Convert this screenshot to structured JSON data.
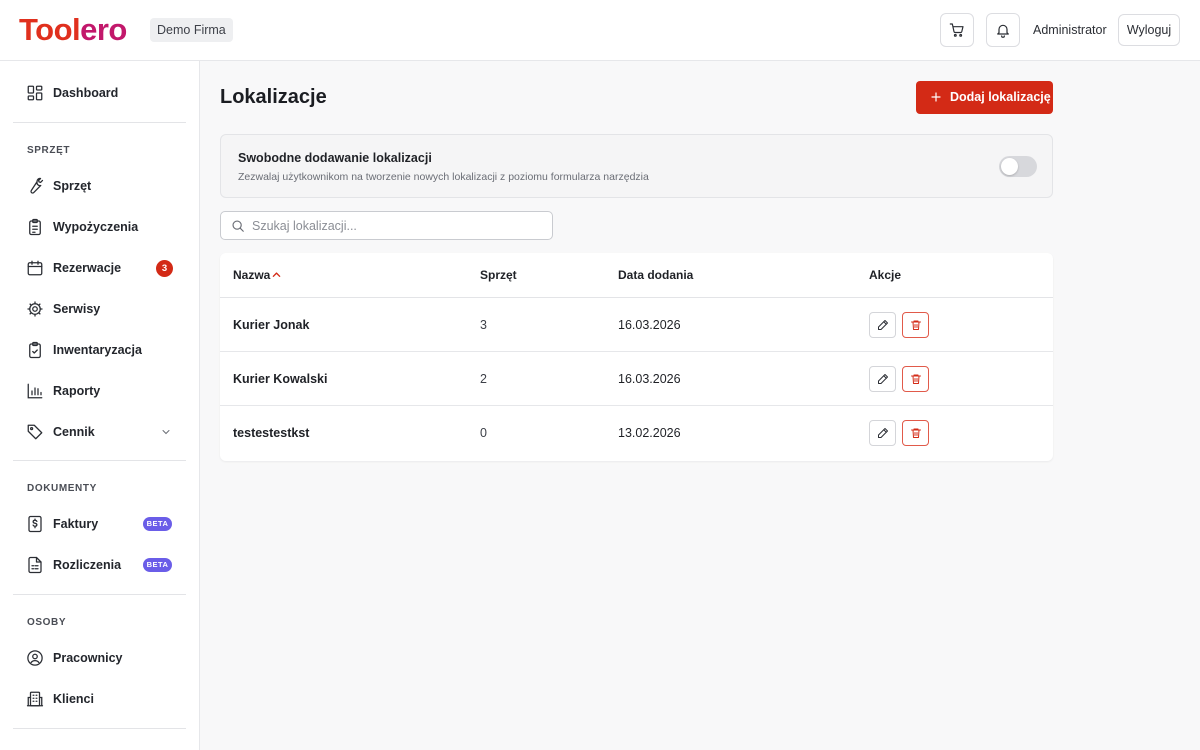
{
  "header": {
    "logo_part1": "Tool",
    "logo_part2": "ero",
    "company": "Demo Firma",
    "user": "Administrator",
    "logout_label": "Wyloguj",
    "cart_icon": "cart-icon",
    "bell_icon": "bell-icon"
  },
  "sidebar": {
    "dashboard": "Dashboard",
    "sections": {
      "equipment": "SPRZĘT",
      "documents": "DOKUMENTY",
      "people": "OSOBY"
    },
    "items": {
      "sprzet": "Sprzęt",
      "wypozyczenia": "Wypożyczenia",
      "rezerwacje": "Rezerwacje",
      "rezerwacje_badge": "3",
      "serwisy": "Serwisy",
      "inwentaryzacja": "Inwentaryzacja",
      "raporty": "Raporty",
      "cennik": "Cennik",
      "faktury": "Faktury",
      "faktury_badge": "BETA",
      "rozliczenia": "Rozliczenia",
      "rozliczenia_badge": "BETA",
      "pracownicy": "Pracownicy",
      "klienci": "Klienci"
    }
  },
  "main": {
    "title": "Lokalizacje",
    "add_button": "Dodaj lokalizację",
    "setting": {
      "title": "Swobodne dodawanie lokalizacji",
      "description": "Zezwalaj użytkownikom na tworzenie nowych lokalizacji z poziomu formularza narzędzia",
      "enabled": false
    },
    "search": {
      "placeholder": "Szukaj lokalizacji...",
      "value": ""
    },
    "table": {
      "columns": {
        "name": "Nazwa",
        "equipment": "Sprzęt",
        "date": "Data dodania",
        "actions": "Akcje"
      },
      "sort": {
        "column": "Nazwa",
        "direction": "asc"
      },
      "rows": [
        {
          "name": "Kurier Jonak",
          "equipment": "3",
          "date": "16.03.2026"
        },
        {
          "name": "Kurier Kowalski",
          "equipment": "2",
          "date": "16.03.2026"
        },
        {
          "name": "testestestkst",
          "equipment": "0",
          "date": "13.02.2026"
        }
      ]
    }
  },
  "colors": {
    "accent": "#d32a16",
    "logo_red": "#e0301e",
    "logo_magenta": "#c2186b",
    "beta": "#6a5de8"
  }
}
